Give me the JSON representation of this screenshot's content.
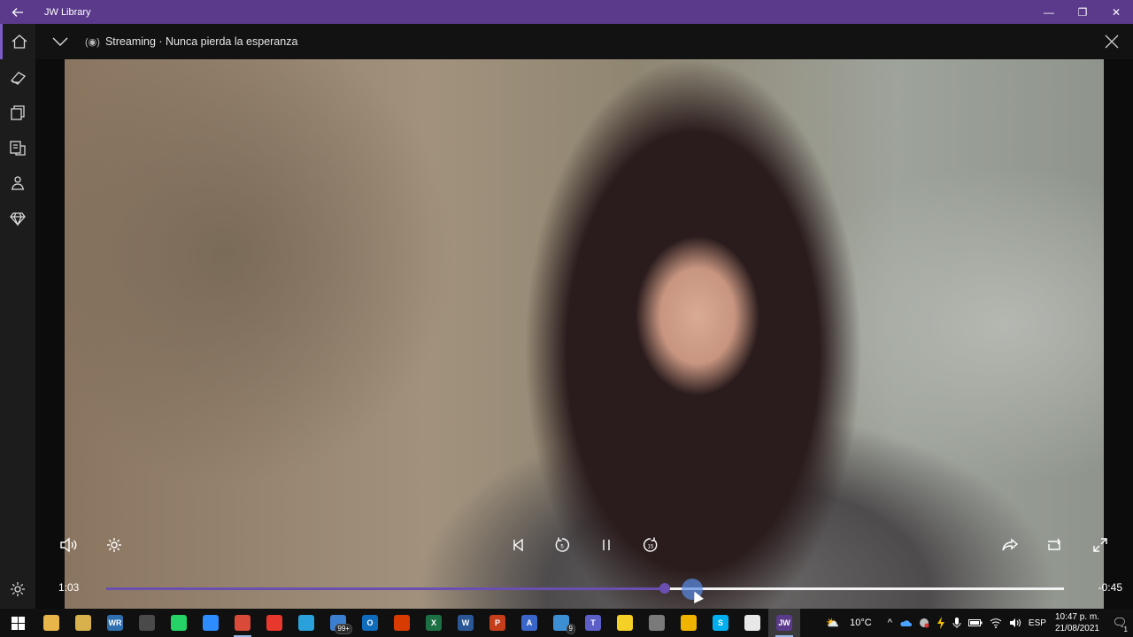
{
  "window": {
    "title": "JW Library",
    "back_icon": "back-arrow-icon",
    "minimize_glyph": "—",
    "maximize_glyph": "❐",
    "close_glyph": "✕"
  },
  "rail": {
    "items": [
      {
        "name": "home",
        "icon": "home-icon",
        "active": true
      },
      {
        "name": "bible",
        "icon": "book-icon"
      },
      {
        "name": "publications",
        "icon": "library-icon"
      },
      {
        "name": "media",
        "icon": "media-icon"
      },
      {
        "name": "meetings",
        "icon": "person-icon"
      },
      {
        "name": "personal-study",
        "icon": "diamond-icon"
      }
    ],
    "settings_icon": "gear-icon"
  },
  "player": {
    "streaming_glyph": "(◉)",
    "title": "Streaming · Nunca pierda la esperanza",
    "elapsed": "1:03",
    "remaining": "-0:45",
    "progress": 0.583,
    "hover_position": 0.612,
    "controls": {
      "volume_icon": "speaker-icon",
      "settings_icon": "gear-icon",
      "previous_icon": "skip-previous-icon",
      "rewind_icon": "rewind-5-icon",
      "rewind_label": "5",
      "pause_icon": "pause-icon",
      "forward_icon": "forward-15-icon",
      "forward_label": "15",
      "share_icon": "share-icon",
      "repeat_icon": "repeat-icon",
      "fullscreen_icon": "fullscreen-icon"
    }
  },
  "taskbar": {
    "apps": [
      {
        "name": "file-explorer",
        "color": "#e8b54a",
        "label": ""
      },
      {
        "name": "files",
        "color": "#d8b04c",
        "label": ""
      },
      {
        "name": "wr-app",
        "color": "#2f6fb0",
        "label": "WR"
      },
      {
        "name": "camera",
        "color": "#4a4a4a",
        "label": ""
      },
      {
        "name": "whatsapp",
        "color": "#25d366",
        "label": ""
      },
      {
        "name": "zoom",
        "color": "#2d8cff",
        "label": ""
      },
      {
        "name": "chrome",
        "color": "#d94a38",
        "label": "",
        "open": true
      },
      {
        "name": "anydesk",
        "color": "#e8372c",
        "label": ""
      },
      {
        "name": "telegram",
        "color": "#2aa1da",
        "label": ""
      },
      {
        "name": "mail",
        "color": "#3c7fd0",
        "label": "",
        "badge": "99+"
      },
      {
        "name": "outlook",
        "color": "#0f6cbd",
        "label": "O"
      },
      {
        "name": "office",
        "color": "#d83b01",
        "label": ""
      },
      {
        "name": "excel",
        "color": "#1d7044",
        "label": "X"
      },
      {
        "name": "word",
        "color": "#2b5797",
        "label": "W"
      },
      {
        "name": "powerpoint",
        "color": "#c43e1c",
        "label": "P"
      },
      {
        "name": "azure",
        "color": "#3a66c9",
        "label": "A"
      },
      {
        "name": "notes",
        "color": "#3d8fd4",
        "label": "",
        "badge": "9"
      },
      {
        "name": "teams",
        "color": "#5b5fc7",
        "label": "T"
      },
      {
        "name": "sticky-notes",
        "color": "#f5d128",
        "label": ""
      },
      {
        "name": "network",
        "color": "#7a7a7a",
        "label": ""
      },
      {
        "name": "power-automate",
        "color": "#f0b400",
        "label": ""
      },
      {
        "name": "skype",
        "color": "#00aff0",
        "label": "S"
      },
      {
        "name": "store",
        "color": "#e8e8e8",
        "label": ""
      },
      {
        "name": "jw-library",
        "color": "#5b3a8c",
        "label": "JW",
        "active": true
      }
    ],
    "weather_glyph": "⛅",
    "temperature": "10°C",
    "tray_chevron": "^",
    "language": "ESP",
    "time": "10:47 p. m.",
    "date": "21/08/2021",
    "notification_glyph": "🗨",
    "notification_count": "1"
  }
}
